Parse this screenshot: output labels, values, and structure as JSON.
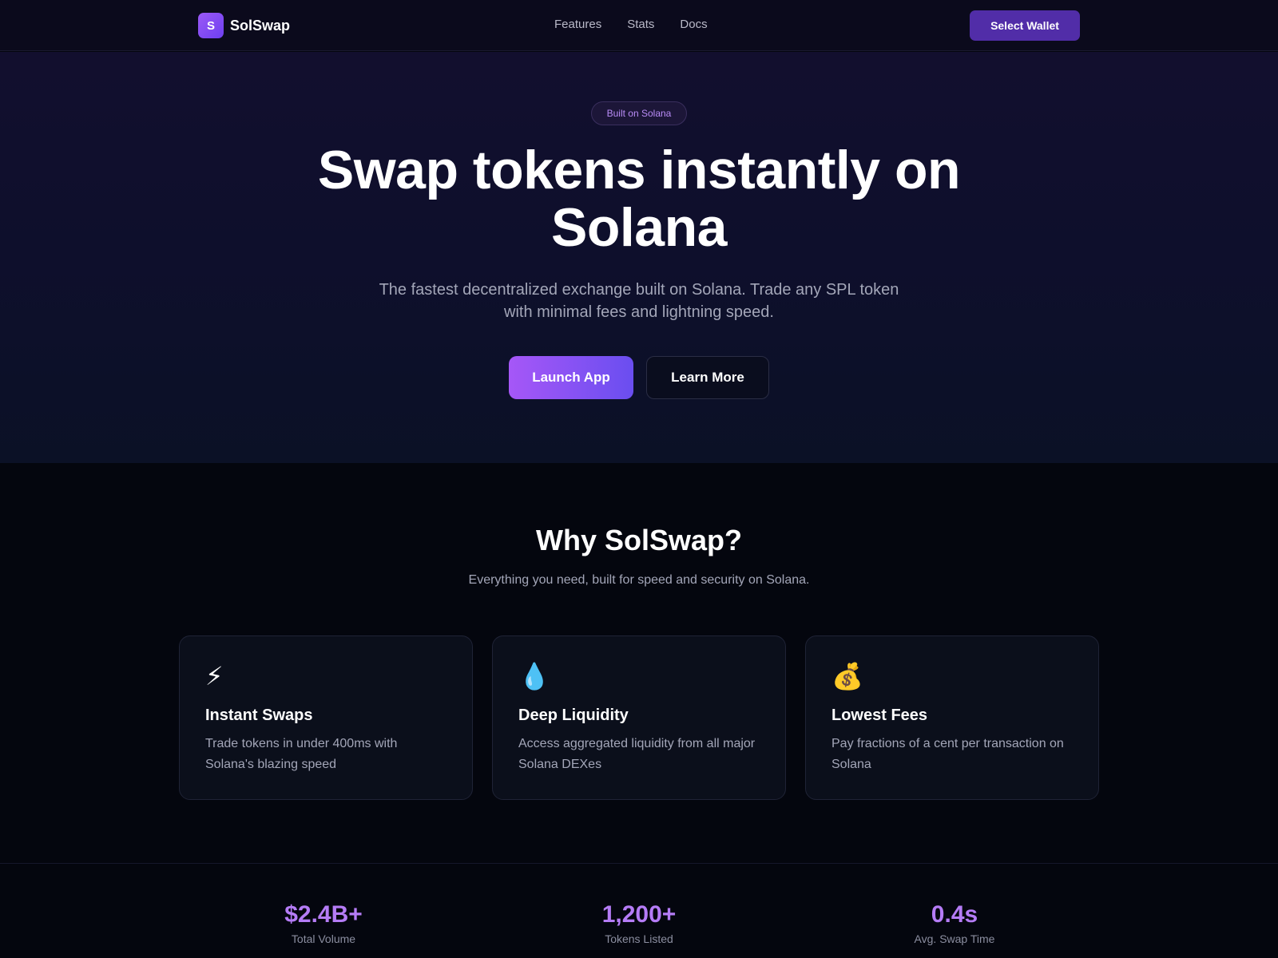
{
  "nav": {
    "brand_mark": "S",
    "brand_name": "SolSwap",
    "links": [
      "Features",
      "Stats",
      "Docs"
    ],
    "wallet_button": "Select Wallet"
  },
  "hero": {
    "badge": "Built on Solana",
    "title_line1": "Swap tokens instantly on",
    "title_line2": "Solana",
    "subtitle": "The fastest decentralized exchange built on Solana. Trade any SPL token with minimal fees and lightning speed.",
    "primary_button": "Launch App",
    "secondary_button": "Learn More"
  },
  "features": {
    "title": "Why SolSwap?",
    "subtitle": "Everything you need, built for speed and security on Solana.",
    "cards": [
      {
        "icon": "lightning-icon",
        "glyph": "⚡",
        "title": "Instant Swaps",
        "description": "Trade tokens in under 400ms with Solana's blazing speed"
      },
      {
        "icon": "droplet-icon",
        "glyph": "💧",
        "title": "Deep Liquidity",
        "description": "Access aggregated liquidity from all major Solana DEXes"
      },
      {
        "icon": "money-bag-icon",
        "glyph": "💰",
        "title": "Lowest Fees",
        "description": "Pay fractions of a cent per transaction on Solana"
      }
    ]
  },
  "stats": [
    {
      "value": "$2.4B+",
      "label": "Total Volume"
    },
    {
      "value": "1,200+",
      "label": "Tokens Listed"
    },
    {
      "value": "0.4s",
      "label": "Avg. Swap Time"
    }
  ],
  "colors": {
    "accent_purple": "#b57cf6",
    "wallet_button": "#512da8",
    "launch_gradient_start": "#a657f7",
    "launch_gradient_end": "#6a4ef0"
  }
}
